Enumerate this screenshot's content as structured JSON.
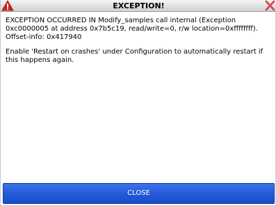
{
  "window": {
    "title": "EXCEPTION!",
    "left_icon": "warning-icon",
    "right_icon": "close-icon"
  },
  "message": {
    "error": "EXCEPTION OCCURRED IN Modify_samples call internal (Exception 0xc0000005 at address 0x7b5c19, read/write=0, r/w location=0xffffffff). Offset-info: 0x417940",
    "hint": "Enable 'Restart on crashes' under Configuration to automatically restart if this happens again."
  },
  "footer": {
    "close_label": "CLOSE"
  },
  "colors": {
    "warning_red": "#d42020",
    "button_blue": "#245bd9",
    "button_text": "#ffffff"
  }
}
